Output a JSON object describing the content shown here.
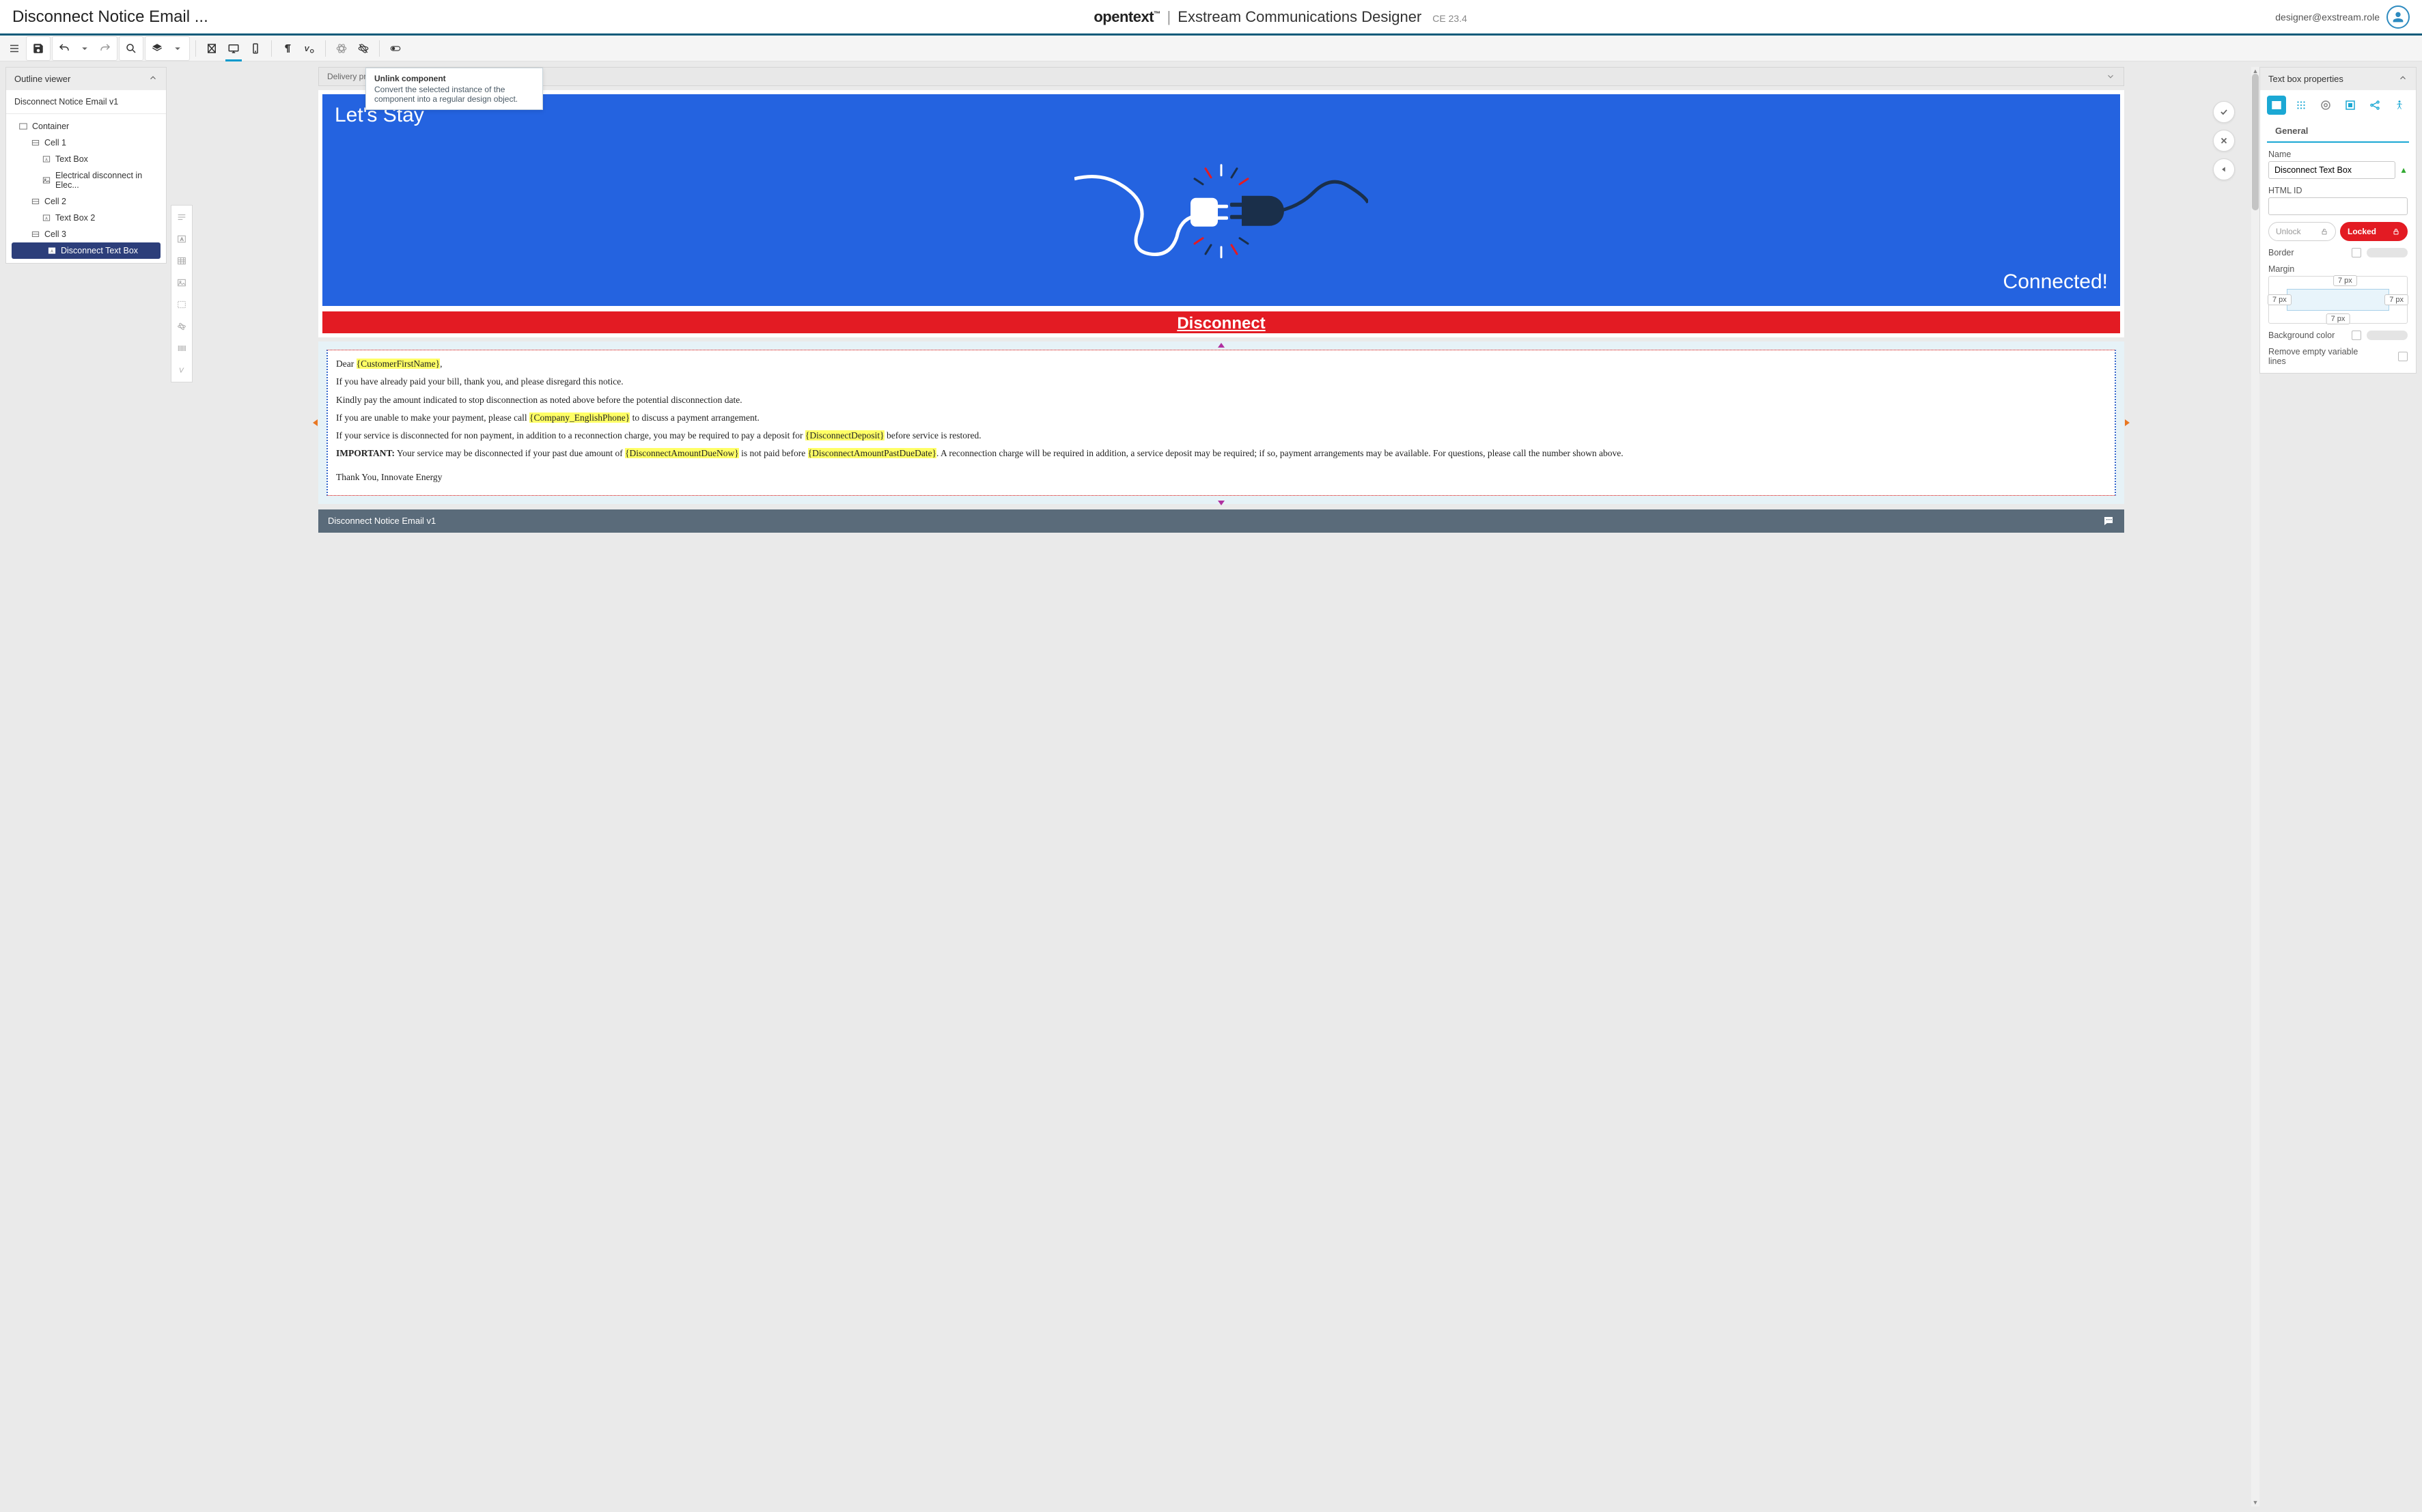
{
  "header": {
    "doc_title": "Disconnect Notice Email ...",
    "brand_name": "opentext",
    "brand_tm": "™",
    "app_name": "Exstream Communications Designer",
    "version": "CE 23.4",
    "user_email": "designer@exstream.role"
  },
  "tooltip": {
    "title": "Unlink component",
    "body": "Convert the selected instance of the component into a regular design object."
  },
  "delivery_bar": {
    "label": "Delivery prope"
  },
  "outline": {
    "panel_title": "Outline viewer",
    "doc_name": "Disconnect Notice Email v1",
    "items": [
      {
        "label": "Container",
        "icon": "container",
        "indent": 1
      },
      {
        "label": "Cell 1",
        "icon": "cell",
        "indent": 2
      },
      {
        "label": "Text Box",
        "icon": "textbox",
        "indent": 3
      },
      {
        "label": "Electrical disconnect in Elec...",
        "icon": "image",
        "indent": 3
      },
      {
        "label": "Cell 2",
        "icon": "cell",
        "indent": 2
      },
      {
        "label": "Text Box 2",
        "icon": "textbox",
        "indent": 3
      },
      {
        "label": "Cell 3",
        "icon": "cell",
        "indent": 2
      },
      {
        "label": "Disconnect Text Box",
        "icon": "textbox",
        "indent": 3,
        "selected": true
      }
    ]
  },
  "hero": {
    "top": "Let's Stay",
    "bottom": "Connected!"
  },
  "banner": "Disconnect",
  "content": {
    "greeting_pre": "Dear ",
    "var_customer": "{CustomerFirstName}",
    "greeting_post": ",",
    "p1": "If you have already paid your bill, thank you, and please disregard this notice.",
    "p2": "Kindly pay the amount indicated to stop disconnection as noted above before the potential disconnection date.",
    "p3_a": "If you are unable to make your payment, please call ",
    "var_phone": "{Company_EnglishPhone}",
    "p3_b": " to discuss a payment arrangement.",
    "p4_a": "If your service is disconnected for non payment, in addition to a reconnection charge, you may be required to pay a deposit for ",
    "var_deposit": "{DisconnectDeposit}",
    "p4_b": " before service is restored.",
    "p5_imp": "IMPORTANT:",
    "p5_a": " Your service may be disconnected if your past due amount of ",
    "var_amount": "{DisconnectAmountDueNow}",
    "p5_b": " is not paid before ",
    "var_date": "{DisconnectAmountPastDueDate}",
    "p5_c": ". A reconnection charge will be required in addition, a service deposit may be required; if so, payment arrangements may be available. For questions, please call the number shown above.",
    "signoff": "Thank You, Innovate Energy"
  },
  "footer": {
    "label": "Disconnect Notice Email v1"
  },
  "props": {
    "panel_title": "Text box properties",
    "section": "General",
    "name_label": "Name",
    "name_value": "Disconnect Text Box",
    "htmlid_label": "HTML ID",
    "htmlid_value": "",
    "unlock": "Unlock",
    "locked": "Locked",
    "border_label": "Border",
    "margin_label": "Margin",
    "margin": {
      "top": "7",
      "right": "7",
      "bottom": "7",
      "left": "7",
      "unit": "px"
    },
    "bgcolor_label": "Background color",
    "remove_empty_label": "Remove empty variable lines"
  }
}
